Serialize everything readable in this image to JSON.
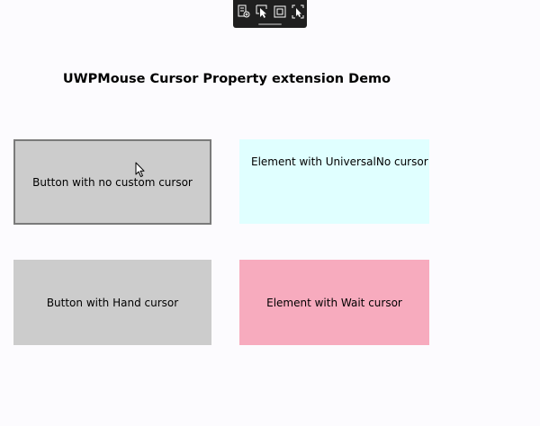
{
  "window": {
    "title": "UWPMouse Cursor Property extension Demo"
  },
  "debug_toolbar": {
    "tools": [
      {
        "icon": "visual-tree-icon"
      },
      {
        "icon": "select-element-icon"
      },
      {
        "icon": "display-layout-adorners-icon"
      },
      {
        "icon": "track-focus-icon"
      }
    ]
  },
  "demo_items": {
    "button_no_cursor": {
      "label": "Button with no custom cursor"
    },
    "element_universalno": {
      "label": "Element with UniversalNo cursor"
    },
    "button_hand": {
      "label": "Button with Hand cursor"
    },
    "element_wait": {
      "label": "Element with Wait cursor"
    }
  },
  "colors": {
    "button_background": "#cccccc",
    "universalno_background": "#e0ffff",
    "wait_background": "#f7abbe",
    "toolbar_background": "#1f1f1f"
  }
}
